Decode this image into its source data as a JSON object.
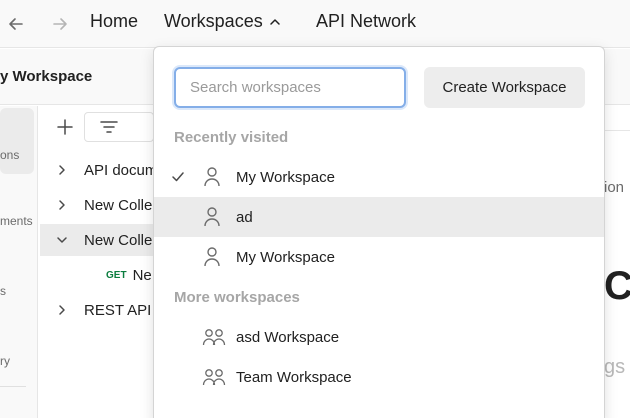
{
  "topbar": {
    "home": "Home",
    "workspaces": "Workspaces",
    "api_network": "API Network"
  },
  "header": {
    "title": "y Workspace"
  },
  "rail": {
    "items": [
      "ons",
      "ments",
      "s",
      "ry"
    ]
  },
  "tree": {
    "rows": [
      {
        "label": "API docum",
        "expanded": false
      },
      {
        "label": "New Colle",
        "expanded": false
      },
      {
        "label": "New Colle",
        "expanded": true
      },
      {
        "label": "Ne",
        "method": "GET"
      },
      {
        "label": "REST API",
        "expanded": false
      }
    ]
  },
  "right": {
    "snippet": "ion",
    "heading": "C",
    "faded": "gs e"
  },
  "dropdown": {
    "search_placeholder": "Search workspaces",
    "create_label": "Create Workspace",
    "recent_label": "Recently visited",
    "recent": [
      {
        "name": "My Workspace",
        "icon": "person-icon",
        "checked": true
      },
      {
        "name": "ad",
        "icon": "person-icon",
        "checked": false
      },
      {
        "name": "My Workspace",
        "icon": "person-icon",
        "checked": false
      }
    ],
    "more_label": "More workspaces",
    "more": [
      {
        "name": "asd Workspace",
        "icon": "team-icon"
      },
      {
        "name": "Team Workspace",
        "icon": "team-icon"
      }
    ]
  },
  "colors": {
    "accent_focus": "#84aee8",
    "get_method": "#0a7d3e",
    "hover_row": "#ebebeb"
  }
}
